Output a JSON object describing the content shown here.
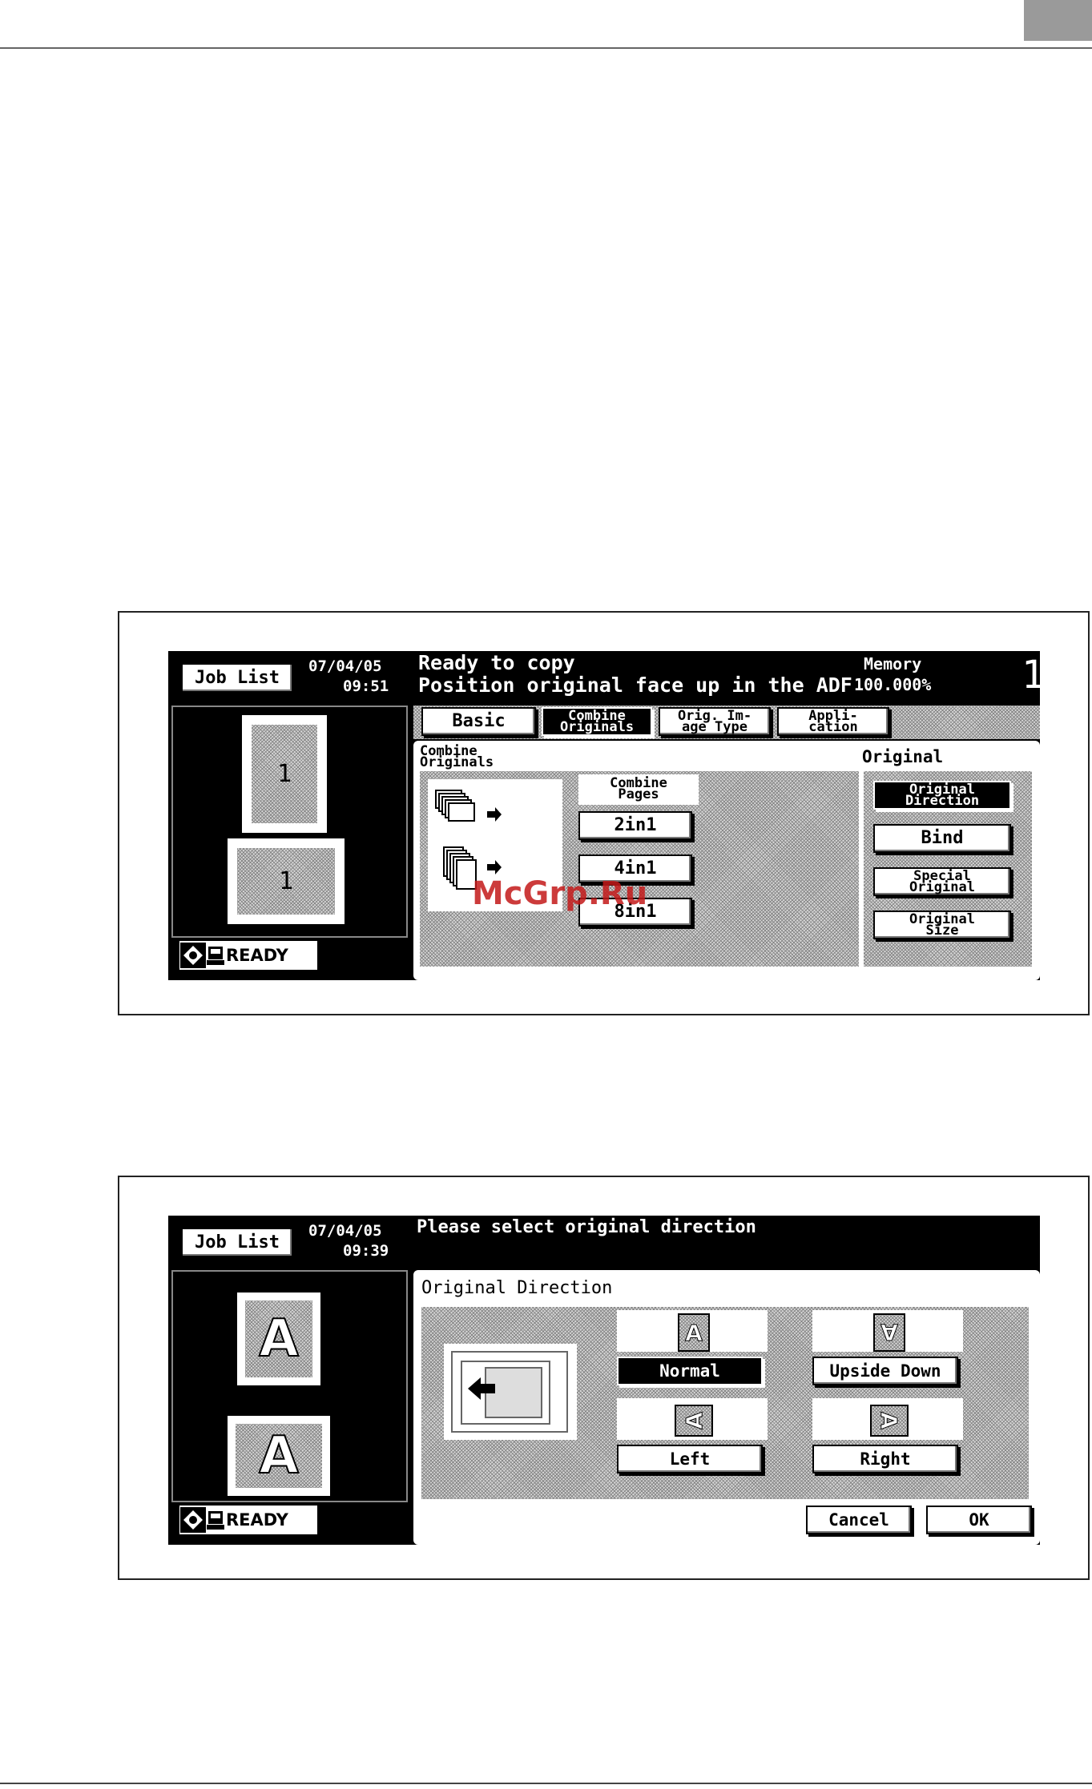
{
  "screen1": {
    "job_list_label": "Job List",
    "date": "07/04/05",
    "time": "09:51",
    "message_line1": "Ready to copy",
    "message_line2": "Position original face up in the ADF",
    "memory_label": "Memory",
    "memory_value": "100.000%",
    "copy_count": "1",
    "tabs": [
      {
        "label": "Basic"
      },
      {
        "label": "Combine\nOriginals"
      },
      {
        "label": "Orig. Im-\nage Type"
      },
      {
        "label": "Appli-\ncation"
      }
    ],
    "section_title": "Combine\nOriginals",
    "combine_pages_label": "Combine\nPages",
    "combine_options": [
      "2in1",
      "4in1",
      "8in1"
    ],
    "original_label": "Original",
    "original_buttons": [
      {
        "label": "Original\nDirection"
      },
      {
        "label": "Bind"
      },
      {
        "label": "Special\nOriginal"
      },
      {
        "label": "Original\nSize"
      }
    ],
    "preview_page_numbers": [
      "1",
      "1"
    ],
    "status_text": "READY"
  },
  "screen2": {
    "job_list_label": "Job List",
    "date": "07/04/05",
    "time": "09:39",
    "message": "Please select original direction",
    "section_title": "Original Direction",
    "direction_options": [
      {
        "label": "Normal",
        "glyph": "A"
      },
      {
        "label": "Upside Down",
        "glyph": "A"
      },
      {
        "label": "Left",
        "glyph": "A"
      },
      {
        "label": "Right",
        "glyph": "A"
      }
    ],
    "preview_glyphs": [
      "A",
      "A"
    ],
    "cancel_label": "Cancel",
    "ok_label": "OK",
    "status_text": "READY"
  },
  "watermark": "McGrp.Ru",
  "icons": {
    "status": "copier-status-icon",
    "machine": "machine-icon",
    "arrow": "arrow-left-icon"
  }
}
